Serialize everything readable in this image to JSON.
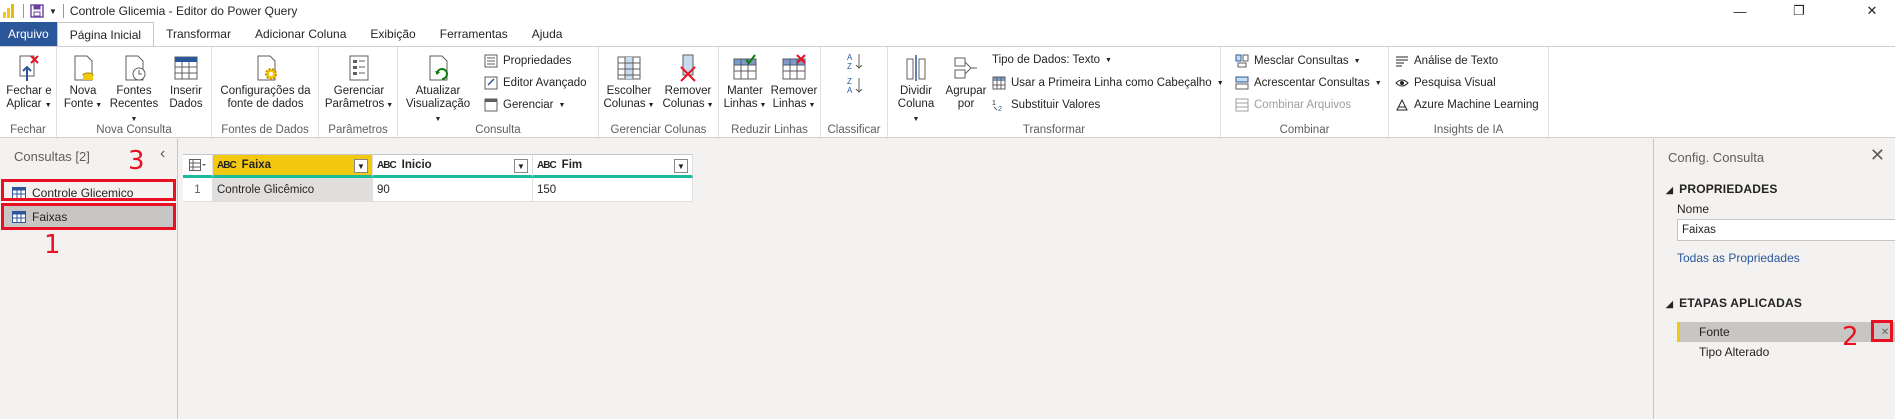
{
  "window": {
    "title": "Controle Glicemia - Editor do Power Query",
    "minimize": "—",
    "restore": "❐",
    "close": "✕"
  },
  "tabs": [
    "Arquivo",
    "Página Inicial",
    "Transformar",
    "Adicionar Coluna",
    "Exibição",
    "Ferramentas",
    "Ajuda"
  ],
  "ribbon": {
    "fechar": {
      "label": "Fechar",
      "btn": [
        "Fechar e",
        "Aplicar"
      ]
    },
    "nova_consulta": {
      "label": "Nova Consulta",
      "btns": [
        [
          "Nova",
          "Fonte"
        ],
        [
          "Fontes",
          "Recentes"
        ],
        [
          "Inserir",
          "Dados"
        ]
      ]
    },
    "fontes_dados": {
      "label": "Fontes de Dados",
      "btn": [
        "Configurações da",
        "fonte de dados"
      ]
    },
    "parametros": {
      "label": "Parâmetros",
      "btn": [
        "Gerenciar",
        "Parâmetros"
      ]
    },
    "consulta": {
      "label": "Consulta",
      "btn": [
        "Atualizar",
        "Visualização"
      ],
      "small": [
        "Propriedades",
        "Editor Avançado",
        "Gerenciar"
      ]
    },
    "gerenciar_colunas": {
      "label": "Gerenciar Colunas",
      "btns": [
        [
          "Escolher",
          "Colunas"
        ],
        [
          "Remover",
          "Colunas"
        ]
      ]
    },
    "reduzir_linhas": {
      "label": "Reduzir Linhas",
      "btns": [
        [
          "Manter",
          "Linhas"
        ],
        [
          "Remover",
          "Linhas"
        ]
      ]
    },
    "classificar": {
      "label": "Classificar"
    },
    "transformar": {
      "label": "Transformar",
      "btns": [
        [
          "Dividir",
          "Coluna"
        ],
        [
          "Agrupar",
          "por"
        ]
      ],
      "small": [
        "Tipo de Dados: Texto",
        "Usar a Primeira Linha como Cabeçalho",
        "Substituir Valores"
      ]
    },
    "combinar": {
      "label": "Combinar",
      "small": [
        "Mesclar Consultas",
        "Acrescentar Consultas",
        "Combinar Arquivos"
      ]
    },
    "insights": {
      "label": "Insights de IA",
      "small": [
        "Análise de Texto",
        "Pesquisa Visual",
        "Azure Machine Learning"
      ]
    }
  },
  "queries_pane": {
    "title": "Consultas [2]",
    "collapse": "‹",
    "items": [
      "Controle Glicemico",
      "Faixas"
    ],
    "selected": "Faixas"
  },
  "grid": {
    "columns": [
      {
        "name": "Faixa",
        "type": "ABC"
      },
      {
        "name": "Inicio",
        "type": "ABC"
      },
      {
        "name": "Fim",
        "type": "ABC"
      }
    ],
    "rows": [
      {
        "num": "1",
        "cells": [
          "Controle Glicêmico",
          "90",
          "150"
        ]
      }
    ]
  },
  "settings_pane": {
    "title": "Config. Consulta",
    "close": "✕",
    "properties_header": "PROPRIEDADES",
    "name_label": "Nome",
    "name_value": "Faixas",
    "all_properties_link": "Todas as Propriedades",
    "steps_header": "ETAPAS APLICADAS",
    "steps": [
      "Fonte",
      "Tipo Alterado"
    ],
    "step_delete_icon": "✕"
  },
  "annotations": [
    "1",
    "2",
    "3"
  ],
  "colors": {
    "accent_yellow": "#f2c811",
    "file_tab": "#2b579a",
    "annotation_red": "#e81123",
    "column_quality_bar": "#1abc9c"
  }
}
